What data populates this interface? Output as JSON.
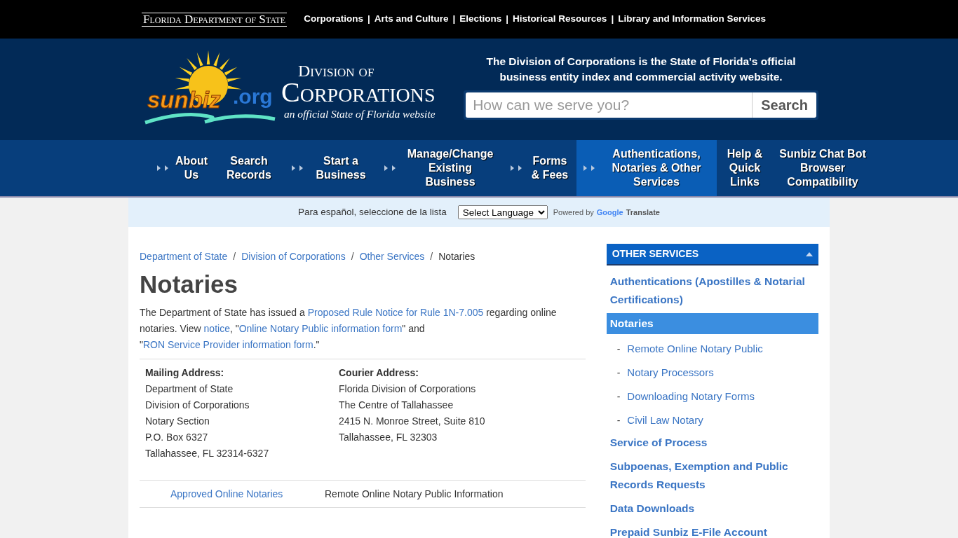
{
  "top_bar": {
    "logo": "Florida Department of State",
    "links": [
      {
        "label": "Corporations"
      },
      {
        "label": "Arts and Culture"
      },
      {
        "label": "Elections"
      },
      {
        "label": "Historical Resources"
      },
      {
        "label": "Library and Information Services"
      }
    ],
    "separator": "|"
  },
  "header": {
    "logo_word": "sunbiz",
    ".org": ".org",
    "division": "Division of",
    "corporations": "Corporations",
    "subtitle": "an official State of Florida website",
    "tagline": "The Division of Corporations is the State of Florida's official business entity index and commercial activity website.",
    "search": {
      "placeholder": "How can we serve you?",
      "button": "Search"
    }
  },
  "nav": [
    {
      "label": "About Us",
      "arrows": true,
      "selected": false
    },
    {
      "label": "Search Records",
      "arrows": false,
      "selected": false
    },
    {
      "label": "Start a Business",
      "arrows": true,
      "selected": false
    },
    {
      "label": "Manage/Change Existing Business",
      "arrows": true,
      "selected": false
    },
    {
      "label": "Forms & Fees",
      "arrows": true,
      "selected": false
    },
    {
      "label": "Authentications, Notaries & Other Services",
      "arrows": true,
      "selected": true
    },
    {
      "label": "Help & Quick Links",
      "arrows": false,
      "selected": false
    },
    {
      "label": "Sunbiz Chat Bot Browser Compatibility",
      "arrows": false,
      "selected": false
    }
  ],
  "translate": {
    "prompt": "Para español, seleccione de la lista",
    "select": "Select Language",
    "powered": "Powered by",
    "google": "Google",
    "translate": "Translate"
  },
  "breadcrumb_separator": "/",
  "breadcrumb": [
    {
      "label": "Department of State",
      "link": true
    },
    {
      "label": "Division of Corporations",
      "link": true
    },
    {
      "label": "Other Services",
      "link": true
    },
    {
      "label": "Notaries",
      "link": false
    }
  ],
  "title": "Notaries",
  "intro": [
    {
      "text": "The Department of State has issued a ",
      "link": false
    },
    {
      "text": "Proposed Rule Notice for Rule 1N-7.005",
      "link": true
    },
    {
      "text": " regarding online notaries. View ",
      "link": false
    },
    {
      "text": "notice",
      "link": true
    },
    {
      "text": ", \"",
      "link": false
    },
    {
      "text": "Online Notary Public information form",
      "link": true
    },
    {
      "text": "\" and \"",
      "link": false
    },
    {
      "text": "RON Service Provider information form",
      "link": true
    },
    {
      "text": ".\"",
      "link": false
    }
  ],
  "addresses": [
    {
      "heading": "Mailing Address:",
      "lines": [
        "Department of State",
        "Division of Corporations",
        "Notary Section",
        "P.O. Box 6327",
        "Tallahassee, FL 32314-6327"
      ]
    },
    {
      "heading": "Courier Address:",
      "lines": [
        "Florida Division of Corporations",
        "The Centre of Tallahassee",
        "2415 N. Monroe Street, Suite 810",
        "Tallahassee, FL 32303"
      ]
    }
  ],
  "resources": [
    {
      "link": "Approved Online Notaries",
      "description": "Remote Online Notary Public Information"
    }
  ],
  "sidebar": {
    "heading": "OTHER SERVICES",
    "expanded": true,
    "items": [
      {
        "kind": "main",
        "label": "Authentications (Apostilles & Notarial Certifications)",
        "selected": false
      },
      {
        "kind": "main",
        "label": "Notaries",
        "selected": true
      },
      {
        "kind": "sub",
        "label": "Remote Online Notary Public",
        "selected": false
      },
      {
        "kind": "sub",
        "label": "Notary Processors",
        "selected": false
      },
      {
        "kind": "sub",
        "label": "Downloading Notary Forms",
        "selected": false
      },
      {
        "kind": "sub",
        "label": "Civil Law Notary",
        "selected": false
      },
      {
        "kind": "main",
        "label": "Service of Process",
        "selected": false
      },
      {
        "kind": "main",
        "label": "Subpoenas, Exemption and Public Records Requests",
        "selected": false
      },
      {
        "kind": "main",
        "label": "Data Downloads",
        "selected": false
      },
      {
        "kind": "main",
        "label": "Prepaid Sunbiz E-File Account",
        "selected": false
      }
    ],
    "dash": "-"
  }
}
